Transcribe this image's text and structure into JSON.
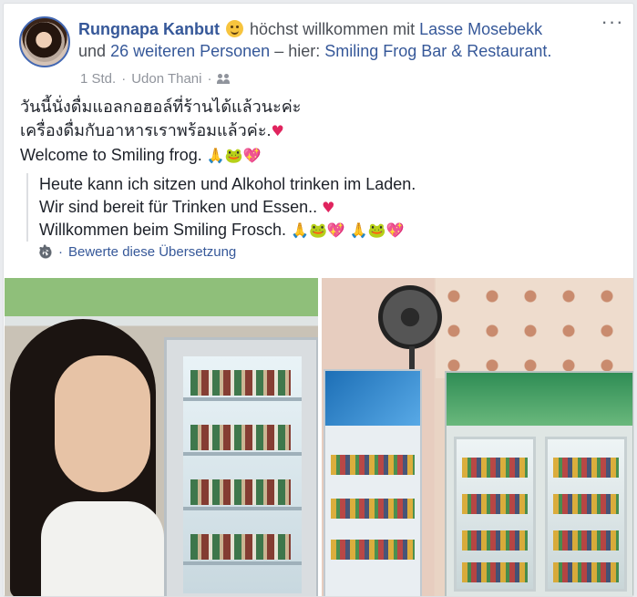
{
  "post": {
    "author": "Rungnapa Kanbut",
    "feeling_prefix": "höchst willkommen mit",
    "tagged_person": "Lasse Mosebekk",
    "others_prefix": "und",
    "others_link": "26 weiteren Personen",
    "location_prefix": "– hier:",
    "location": "Smiling Frog Bar & Restaurant.",
    "time": "1 Std.",
    "place": "Udon Thani",
    "separator": "·",
    "more_icon": "more-options-icon",
    "audience_icon": "friends-icon",
    "lines": [
      "วันนี้นั่งดื่มแอลกอฮอล์ที่ร้านได้แล้วนะค่ะ",
      "เครื่องดื่มกับอาหารเราพร้อมแล้วค่ะ.",
      "Welcome to Smiling frog."
    ],
    "translation": [
      "Heute kann ich sitzen und Alkohol trinken im Laden.",
      "Wir sind bereit für Trinken und Essen..",
      "Willkommen beim Smiling Frosch."
    ],
    "rate_translation": "Bewerte diese Übersetzung",
    "emoji": {
      "heart": "♥",
      "pray": "🙏",
      "frog": "🐸",
      "sparkle_heart": "💖"
    }
  }
}
